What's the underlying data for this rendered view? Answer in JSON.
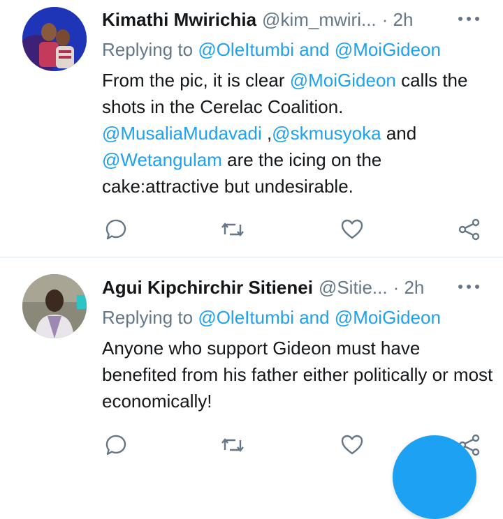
{
  "tweets": [
    {
      "author_name": "Kimathi Mwirichia",
      "handle": "@kim_mwiri...",
      "time": "· 2h",
      "replying_prefix": "Replying to ",
      "replying_to_1": "@OleItumbi",
      "replying_and": " and ",
      "replying_to_2": "@MoiGideon",
      "body": [
        {
          "text": "From the pic, it is clear ",
          "mention": false
        },
        {
          "text": "@MoiGideon",
          "mention": true
        },
        {
          "text": " calls the shots in the Cerelac Coalition. ",
          "mention": false
        },
        {
          "text": "@MusaliaMudavadi",
          "mention": true
        },
        {
          "text": " ,",
          "mention": false
        },
        {
          "text": "@skmusyoka",
          "mention": true
        },
        {
          "text": " and ",
          "mention": false
        },
        {
          "text": "@Wetangulam",
          "mention": true
        },
        {
          "text": " are the icing on the cake:attractive but undesirable.",
          "mention": false
        }
      ]
    },
    {
      "author_name": "Agui Kipchirchir Sitienei",
      "handle": "@Sitie...",
      "time": "· 2h",
      "replying_prefix": "Replying to ",
      "replying_to_1": "@OleItumbi",
      "replying_and": " and ",
      "replying_to_2": "@MoiGideon",
      "body": [
        {
          "text": "Anyone who support Gideon must have benefited from his father either politically or most economically!",
          "mention": false
        }
      ]
    }
  ],
  "colors": {
    "accent": "#1da1f2",
    "secondary_text": "#657786",
    "divider": "#e1e8ed"
  },
  "icons": {
    "reply": "reply-icon",
    "retweet": "retweet-icon",
    "like": "like-icon",
    "share": "share-icon",
    "more": "more-icon"
  }
}
